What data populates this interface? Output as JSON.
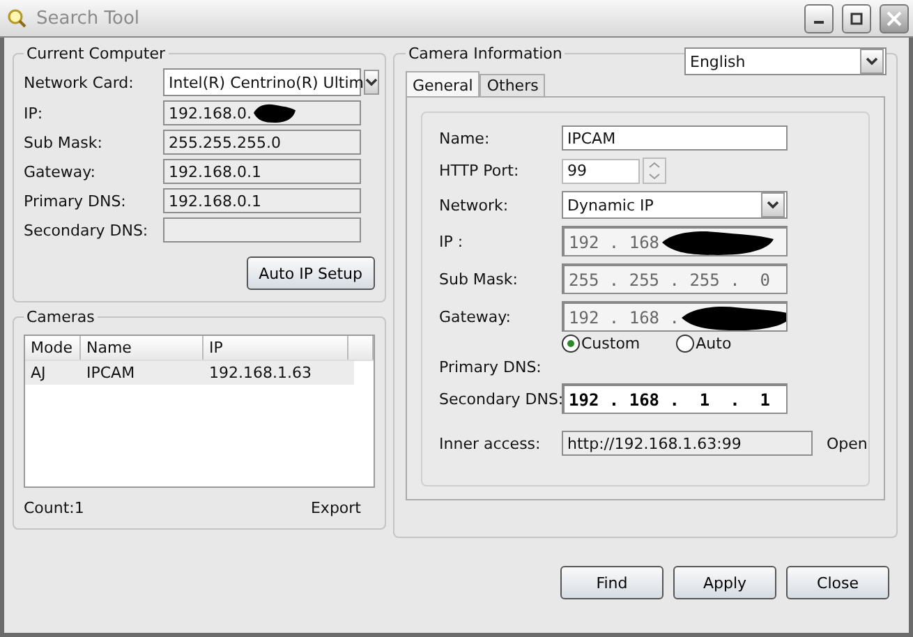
{
  "window": {
    "title": "Search Tool"
  },
  "current_computer": {
    "title": "Current Computer",
    "fields": [
      {
        "label": "Network Card:",
        "kind": "dropdown",
        "value": "Intel(R) Centrino(R) Ultim"
      },
      {
        "label": "IP:",
        "kind": "text",
        "value": "192.168.0.",
        "redacted": true
      },
      {
        "label": "Sub Mask:",
        "kind": "text",
        "value": "255.255.255.0"
      },
      {
        "label": "Gateway:",
        "kind": "text",
        "value": "192.168.0.1"
      },
      {
        "label": "Primary DNS:",
        "kind": "text",
        "value": "192.168.0.1"
      },
      {
        "label": "Secondary DNS:",
        "kind": "text"
      }
    ],
    "button": "Auto IP Setup"
  },
  "cameras": {
    "title": "Cameras",
    "columns": [
      "Mode",
      "Name",
      "IP"
    ],
    "rows": [
      {
        "cells": [
          "AJ",
          "IPCAM",
          "192.168.1.63"
        ],
        "selected": true
      }
    ],
    "count": "Count:1",
    "export": "Export"
  },
  "camera_info": {
    "title": "Camera Information",
    "language": "English",
    "tabs": [
      {
        "label": "General",
        "selected": true
      },
      {
        "label": "Others",
        "selected": false
      }
    ],
    "fields": [
      {
        "label": "Name:",
        "kind": "text",
        "value": "IPCAM"
      },
      {
        "label": "HTTP Port:",
        "kind": "spin",
        "value": "99"
      },
      {
        "label": "Network:",
        "kind": "dropdown",
        "value": "Dynamic IP"
      },
      {
        "label": "IP :",
        "kind": "ip",
        "value": "192 . 168",
        "disabled": true,
        "redacted": true
      },
      {
        "label": "Sub Mask:",
        "kind": "ip",
        "value": "255 . 255 . 255 .  0",
        "disabled": true
      },
      {
        "label": "Gateway:",
        "kind": "ip",
        "value": "192 . 168 .",
        "disabled": true,
        "redacted": true
      },
      {
        "kind": "radios",
        "options": [
          {
            "label": "Custom",
            "selected": true
          },
          {
            "label": "Auto",
            "selected": false
          }
        ]
      },
      {
        "label": "Primary DNS:",
        "kind": "none"
      },
      {
        "label": "Secondary DNS:",
        "kind": "ip",
        "value": "192 . 168 .  1  .  1",
        "disabled": false
      }
    ],
    "inner_access": {
      "label": "Inner access:",
      "value": "http://192.168.1.63:99",
      "link": "Open"
    }
  },
  "buttons": [
    "Find",
    "Apply",
    "Close"
  ]
}
